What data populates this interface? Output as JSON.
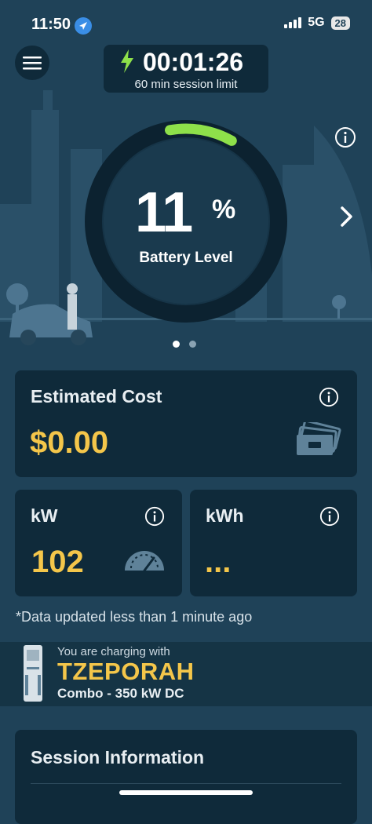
{
  "status_bar": {
    "time": "11:50",
    "network": "5G",
    "battery": "28"
  },
  "session": {
    "elapsed": "00:01:26",
    "limit": "60 min session limit"
  },
  "battery": {
    "percent": "11",
    "percent_symbol": "%",
    "label": "Battery Level",
    "level": 0.11
  },
  "carousel": {
    "pages": 2,
    "active": 0
  },
  "estimated_cost": {
    "title": "Estimated Cost",
    "value": "$0.00",
    "icon": "cash-icon"
  },
  "kw": {
    "title": "kW",
    "value": "102",
    "icon": "gauge-icon"
  },
  "kwh": {
    "title": "kWh",
    "value": "..."
  },
  "updated_note": "*Data updated less than 1 minute ago",
  "charger": {
    "intro": "You are charging with",
    "name": "TZEPORAH",
    "connector": "Combo - 350 kW DC"
  },
  "session_info": {
    "title": "Session Information"
  },
  "colors": {
    "background": "#1f4258",
    "card": "#0f2a3a",
    "accent": "#f4c64a",
    "ring_progress": "#8ee04a"
  }
}
